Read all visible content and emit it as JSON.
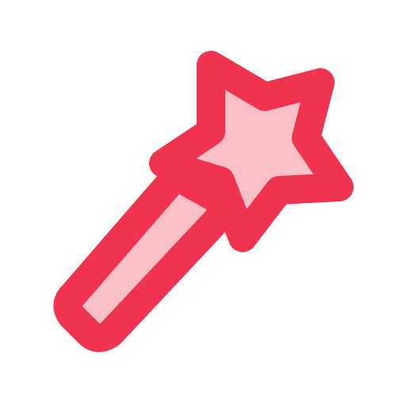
{
  "icon": {
    "name": "magic-wand-icon",
    "stroke_color": "#f0334f",
    "fill_color": "#f9c0c8",
    "background": "#ffffff"
  }
}
